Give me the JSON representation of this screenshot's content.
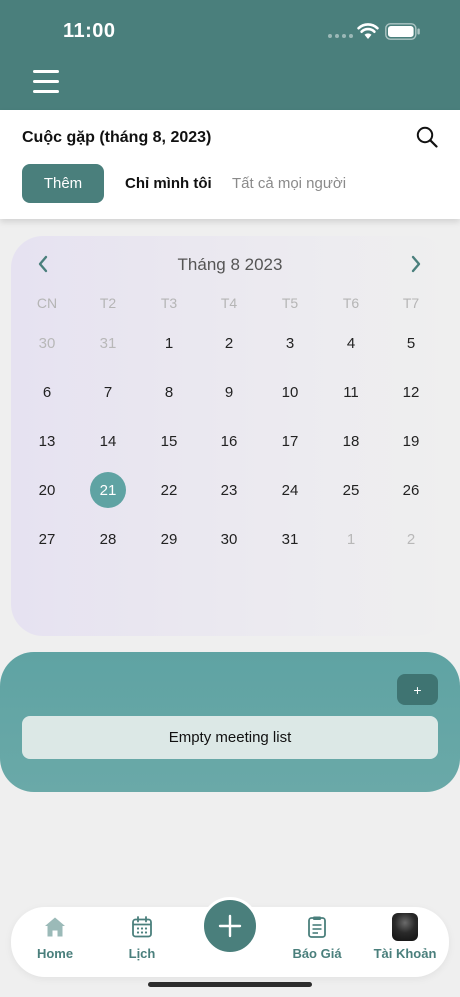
{
  "status_bar": {
    "time": "11:00"
  },
  "header": {
    "title": "Cuộc gặp (tháng 8, 2023)",
    "add_label": "Thêm",
    "filter_mine": "Chỉ mình tôi",
    "filter_all": "Tất cả mọi người"
  },
  "calendar": {
    "month_title": "Tháng 8 2023",
    "weekdays": [
      "CN",
      "T2",
      "T3",
      "T4",
      "T5",
      "T6",
      "T7"
    ],
    "weeks": [
      [
        "30",
        "31",
        "1",
        "2",
        "3",
        "4",
        "5"
      ],
      [
        "6",
        "7",
        "8",
        "9",
        "10",
        "11",
        "12"
      ],
      [
        "13",
        "14",
        "15",
        "16",
        "17",
        "18",
        "19"
      ],
      [
        "20",
        "21",
        "22",
        "23",
        "24",
        "25",
        "26"
      ],
      [
        "27",
        "28",
        "29",
        "30",
        "31",
        "1",
        "2"
      ]
    ],
    "selected_day": "21"
  },
  "meetings": {
    "add_label": "+",
    "empty_text": "Empty meeting list"
  },
  "tabbar": {
    "home": "Home",
    "calendar": "Lịch",
    "quote": "Báo Giá",
    "account": "Tài Khoản"
  },
  "colors": {
    "primary": "#4a7f7c",
    "accent": "#5fa3a3",
    "muted_text": "#8a8a8a"
  },
  "icons": [
    "menu-icon",
    "search-icon",
    "chevron-left-icon",
    "chevron-right-icon",
    "home-icon",
    "calendar-icon",
    "plus-icon",
    "document-icon"
  ]
}
